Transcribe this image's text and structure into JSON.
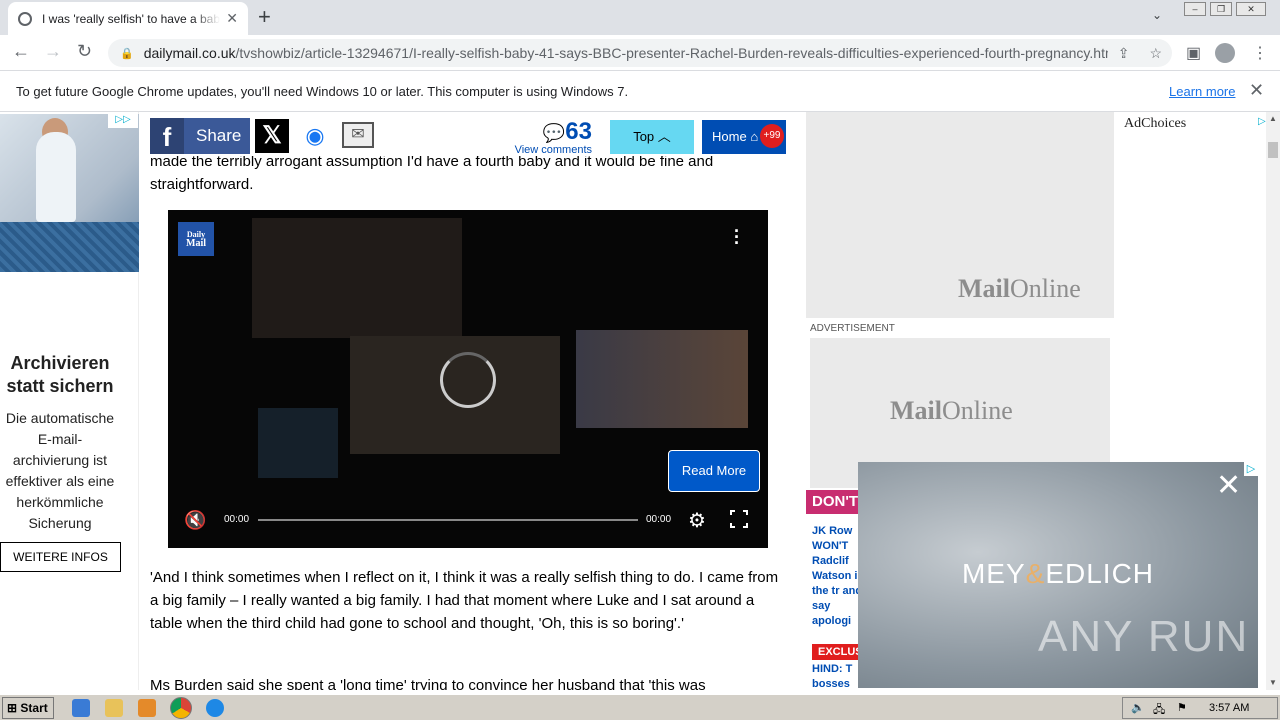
{
  "browser": {
    "tab_title": "I was 'really selfish' to have a baby at",
    "url_domain": "dailymail.co.uk",
    "url_path": "/tvshowbiz/article-13294671/I-really-selfish-baby-41-says-BBC-presenter-Rachel-Burden-reveals-difficulties-experienced-fourth-pregnancy.html",
    "infobar_message": "To get future Google Chrome updates, you'll need Windows 10 or later. This computer is using Windows 7.",
    "infobar_link": "Learn more"
  },
  "left_ad": {
    "headline": "Archivieren statt sichern",
    "body": "Die automatische E-mail-archivierung ist effektiver als eine herkömmliche Sicherung",
    "button": "WEITERE INFOS"
  },
  "sharebar": {
    "share_label": "Share",
    "comments_count": "63",
    "comments_label": "View comments",
    "top_label": "Top",
    "home_label": "Home",
    "home_badge": "+99"
  },
  "article": {
    "para_partial": "made the terribly arrogant assumption I'd have a fourth baby and it would be fine and straightforward.",
    "para2": "'And I think sometimes when I reflect on it, I think it was a really selfish thing to do. I came from a big family – I really wanted a big family. I had that moment where Luke and I sat around a table when the third child had gone to school and thought, 'Oh, this is so boring'.'",
    "para3": "Ms Burden said she spent a 'long time' trying to convince her husband that 'this was"
  },
  "video": {
    "logo_line1": "Daily",
    "logo_line2": "Mail",
    "read_more": "Read More",
    "time_current": "00:00",
    "time_total": "00:00"
  },
  "right_col": {
    "adchoices": "AdChoices",
    "mail_online_bold": "Mail",
    "mail_online_light": "Online",
    "advertisement": "ADVERTISEMENT",
    "dont_miss": "DON'T",
    "news1": "JK Row WON'T Radclif Watson in the tr and say apologi",
    "exclusive": "EXCLUS",
    "news2": "HIND: T bosses"
  },
  "overlay_ad": {
    "brand_left": "MEY",
    "brand_amp": "&",
    "brand_right": "EDLICH",
    "watermark": "ANY RUN"
  },
  "taskbar": {
    "start_label": "Start",
    "clock": "3:57 AM"
  }
}
